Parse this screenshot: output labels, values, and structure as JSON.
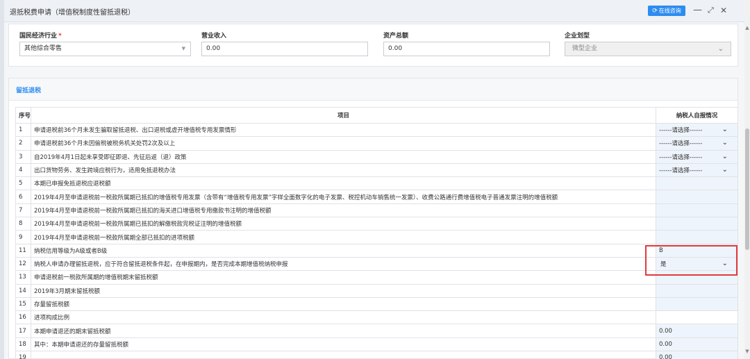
{
  "dialog": {
    "title": "退抵税费申请（增值税制度性留抵退税）",
    "consult_label": "在线咨询",
    "minimize": "—",
    "restore": "⤢",
    "close": "✕"
  },
  "form": {
    "industry": {
      "label": "国民经济行业",
      "value": "其他综合零售"
    },
    "revenue": {
      "label": "营业收入",
      "value": "0.00"
    },
    "assets": {
      "label": "资产总额",
      "value": "0.00"
    },
    "company_type": {
      "label": "企业划型",
      "value": "微型企业"
    }
  },
  "section": {
    "title": "留抵退税",
    "headers": {
      "index": "序号",
      "item": "项目",
      "value": "纳税人自报情况"
    },
    "rows": [
      {
        "idx": "1",
        "item": "申请退税前36个月未发生骗取留抵退税、出口退税或虚开增值税专用发票情形",
        "value": "------请选择------",
        "type": "select"
      },
      {
        "idx": "2",
        "item": "申请退税前36个月未因偷税被税务机关处罚2次及以上",
        "value": "------请选择------",
        "type": "select"
      },
      {
        "idx": "3",
        "item": "自2019年4月1日起未享受即征即退、先征后返（退）政策",
        "value": "------请选择------",
        "type": "select"
      },
      {
        "idx": "4",
        "item": "出口货物劳务、发生跨境应税行为，适用免抵退税办法",
        "value": "------请选择------",
        "type": "select"
      },
      {
        "idx": "5",
        "item": "本期已申报免抵退税应退税额",
        "value": "",
        "type": "blank"
      },
      {
        "idx": "6",
        "item": "2019年4月至申请退税前一税款所属期已抵扣的增值税专用发票（含带有“增值税专用发票”字样全面数字化的电子发票、税控机动车销售统一发票）、收费公路通行费增值税电子普通发票注明的增值税额",
        "value": "",
        "type": "blank"
      },
      {
        "idx": "7",
        "item": "2019年4月至申请退税前一税款所属期已抵扣的海关进口增值税专用缴款书注明的增值税额",
        "value": "",
        "type": "blank"
      },
      {
        "idx": "8",
        "item": "2019年4月至申请退税前一税款所属期已抵扣的解缴税款完税证注明的增值税额",
        "value": "",
        "type": "blank"
      },
      {
        "idx": "9",
        "item": "2019年4月至申请退税前一税款所属期全部已抵扣的进项税额",
        "value": "",
        "type": "blank"
      },
      {
        "idx": "11",
        "item": "纳税信用等级为A级或者B级",
        "value": "B",
        "type": "text"
      },
      {
        "idx": "12",
        "item": "纳税人申请办理留抵退税，应于符合留抵退税条件起，在申报期内，是否完成本期增值税纳税申报",
        "value": "是",
        "type": "select-yes"
      },
      {
        "idx": "13",
        "item": "申请退税前一税款所属期的增值税期末留抵税额",
        "value": "",
        "type": "blank"
      },
      {
        "idx": "14",
        "item": "2019年3月期末留抵税额",
        "value": "",
        "type": "blank"
      },
      {
        "idx": "15",
        "item": "存量留抵税额",
        "value": "",
        "type": "blank"
      },
      {
        "idx": "16",
        "item": "进项构成比例",
        "value": "",
        "type": "plain"
      },
      {
        "idx": "17",
        "item": "本期申请退还的期末留抵税额",
        "value": "0.00",
        "type": "text"
      },
      {
        "idx": "18",
        "item": "其中：本期申请退还的存量留抵税额",
        "value": "0.00",
        "type": "text"
      },
      {
        "idx": "19",
        "item": "",
        "value": "0.00",
        "type": "text"
      }
    ]
  },
  "scroll": {
    "up": "▲",
    "down": "▼"
  },
  "colors": {
    "accent": "#2d8cf0",
    "highlight": "#e4393c"
  }
}
